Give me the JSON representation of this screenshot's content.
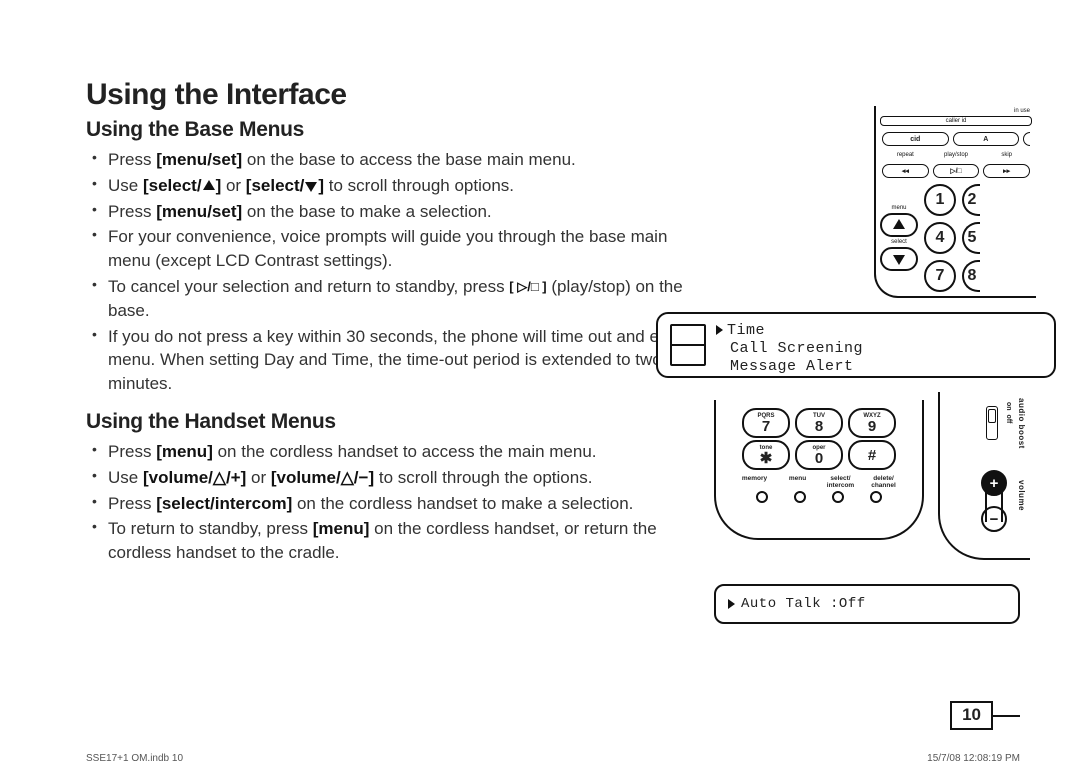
{
  "title": "Using the Interface",
  "sections": {
    "base": {
      "heading": "Using the Base Menus",
      "bullets": {
        "b1a": "Press ",
        "b1_key": "[menu/set]",
        "b1b": " on the base to access the base main menu.",
        "b2a": "Use ",
        "b2_key1a": "[select/",
        "b2_key1b": "]",
        "b2_mid": " or ",
        "b2_key2a": "[select/",
        "b2_key2b": "]",
        "b2b": " to scroll through options.",
        "b3a": "Press ",
        "b3_key": "[menu/set]",
        "b3b": " on the base to make a selection.",
        "b4": "For your convenience, voice prompts will guide you through the base main menu (except LCD Contrast settings).",
        "b5a": "To cancel your selection and return to standby, press ",
        "b5_key": "[ ▷/□ ]",
        "b5b": " (play/stop) on the base.",
        "b6": "If you do not press a key within 30 seconds, the phone will time out and exit the menu. When setting Day and Time, the time-out period is extended to two minutes."
      }
    },
    "handset": {
      "heading": "Using the Handset Menus",
      "bullets": {
        "b1a": "Press ",
        "b1_key": "[menu]",
        "b1b": " on the cordless handset to access the main menu.",
        "b2a": "Use ",
        "b2_key1": "[volume/△/+]",
        "b2_mid": " or ",
        "b2_key2": "[volume/△/−]",
        "b2b": " to scroll through the options.",
        "b3a": "Press ",
        "b3_key": "[select/intercom]",
        "b3b": " on the cordless handset to make a selection.",
        "b4a": "To return to standby, press ",
        "b4_key": "[menu]",
        "b4b": " on the cordless handset, or return the cordless handset to the cradle."
      }
    }
  },
  "illus": {
    "base_labels": {
      "in_use": "in use",
      "caller_id": "caller id",
      "cid": "cid",
      "a": "A",
      "row2": {
        "l": "repeat",
        "m": "play/stop",
        "r": "skip"
      },
      "btns2": {
        "l": "◂◂",
        "m": "▷/□",
        "r": "▸▸"
      },
      "menu": "menu",
      "select": "select"
    },
    "lcd_base": {
      "line1": "Time",
      "line2": "Call Screening",
      "line3": "Message Alert"
    },
    "handset_keys": {
      "row1": [
        {
          "legend": "PQRS",
          "digit": "7"
        },
        {
          "legend": "TUV",
          "digit": "8"
        },
        {
          "legend": "WXYZ",
          "digit": "9"
        }
      ],
      "row2": [
        {
          "legend": "tone",
          "digit": "✱"
        },
        {
          "legend": "oper",
          "digit": "0"
        },
        {
          "legend": "",
          "digit": "#"
        }
      ],
      "fns": [
        "memory",
        "menu",
        "select/\nintercom",
        "delete/\nchannel"
      ]
    },
    "side": {
      "boost": "audio boost",
      "on": "on",
      "off": "off",
      "volume": "volume"
    },
    "lcd_handset": "Auto Talk   :Off"
  },
  "page_number": "10",
  "footer": {
    "left": "SSE17+1 OM.indb   10",
    "right": "15/7/08   12:08:19 PM"
  }
}
